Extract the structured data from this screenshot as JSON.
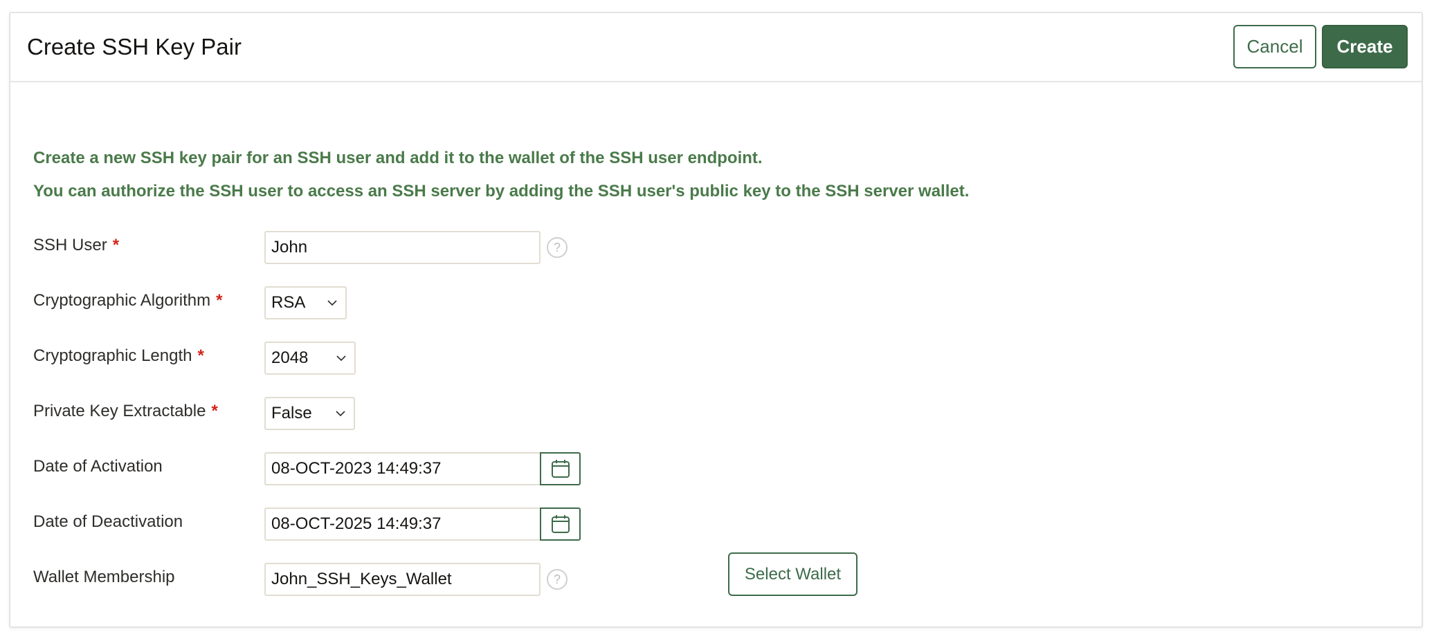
{
  "header": {
    "title": "Create SSH Key Pair",
    "cancel_label": "Cancel",
    "create_label": "Create"
  },
  "intro": {
    "line1": "Create a new SSH key pair for an SSH user and add it to the wallet of the SSH user endpoint.",
    "line2": "You can authorize the SSH user to access an SSH server by adding the SSH user's public key to the SSH server wallet."
  },
  "form": {
    "required_marker": "*",
    "help_glyph": "?",
    "ssh_user": {
      "label": "SSH User",
      "value": "John",
      "required": true
    },
    "algorithm": {
      "label": "Cryptographic Algorithm",
      "value": "RSA",
      "required": true
    },
    "length": {
      "label": "Cryptographic Length",
      "value": "2048",
      "required": true
    },
    "extractable": {
      "label": "Private Key Extractable",
      "value": "False",
      "required": true
    },
    "activation": {
      "label": "Date of Activation",
      "value": "08-OCT-2023 14:49:37"
    },
    "deactivation": {
      "label": "Date of Deactivation",
      "value": "08-OCT-2025 14:49:37"
    },
    "wallet": {
      "label": "Wallet Membership",
      "value": "John_SSH_Keys_Wallet",
      "button_label": "Select Wallet"
    }
  },
  "colors": {
    "accent": "#3d6b4a",
    "intro_text": "#4a7a4a",
    "required": "#d0251c"
  }
}
